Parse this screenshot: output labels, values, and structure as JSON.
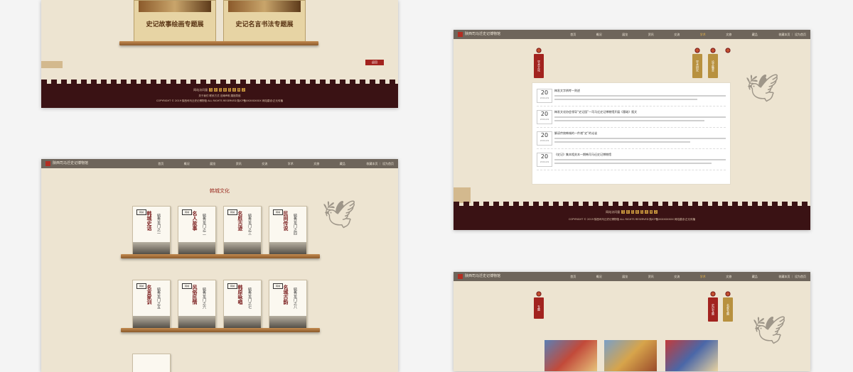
{
  "site_name": "陕西司马迁史记博物馆",
  "nav_items": [
    "首页",
    "概况",
    "展览",
    "资讯",
    "交流",
    "学术",
    "文旅",
    "藏品"
  ],
  "nav_active": "学术",
  "nav_right": "收藏本页 ｜ 设为首页",
  "panel1": {
    "exhibits": [
      "史记故事绘画专题展",
      "史记名言书法专题展"
    ],
    "back_label": "返回",
    "visitor_label": "网站访问量",
    "visitor_digits": [
      "5",
      "0",
      "5",
      "8",
      "5",
      "4",
      "9",
      "2"
    ],
    "footer_links": "关于我们   联系方式   法律声明   展馆导航",
    "copyright": "COPYRIGHT © 2019 陕西司马迁史记博物馆 ALL RIGHTS RESERVED 陕ICP备XXXXXXXXX    网站建设:正元传播"
  },
  "panel2": {
    "section_title": "韩城文化",
    "books": [
      {
        "title": "韩城史话",
        "series": "毓秀龙门之一",
        "seal": "韩城"
      },
      {
        "title": "名人故事",
        "series": "毓秀龙门之二",
        "seal": "韩城"
      },
      {
        "title": "名胜古迹",
        "series": "毓秀龙门之三",
        "seal": "韩城"
      },
      {
        "title": "民间传说",
        "series": "毓秀龙门之四",
        "seal": "韩城"
      },
      {
        "title": "名言家训",
        "series": "毓秀龙门之五",
        "seal": "韩城"
      },
      {
        "title": "风俗民情",
        "series": "毓秀龙门之六",
        "seal": "韩城"
      },
      {
        "title": "韩原咏唱",
        "series": "毓秀龙门之七",
        "seal": "韩城"
      },
      {
        "title": "名城古韵",
        "series": "毓秀龙门之八",
        "seal": "韩城"
      }
    ]
  },
  "panel3": {
    "tags_left": [
      "学术文化"
    ],
    "tags_right": [
      "学术研究",
      "论文集萃"
    ],
    "news": [
      {
        "day": "20",
        "ym": "2019-09",
        "title": "梅发文字辨考一则述"
      },
      {
        "day": "20",
        "ym": "2019-09",
        "title": "梅发文化协会领导“史记园”—司马迁史记博物馆开展《基础》报文"
      },
      {
        "day": "20",
        "ym": "2019-09",
        "title": "解读传统韩城的一件诸“史”的论谈"
      },
      {
        "day": "20",
        "ym": "2019-09",
        "title": "《史记》集本相关本一期韩司马迁史记博物馆"
      }
    ],
    "visitor_label": "网站访问量",
    "visitor_digits": [
      "5",
      "0",
      "5",
      "8",
      "5",
      "4",
      "9",
      "2"
    ],
    "copyright": "COPYRIGHT © 2019 陕西司马迁史记博物馆 ALL RIGHTS RESERVED 陕ICP备XXXXXXXXX    网站建设:正元传播"
  },
  "panel4": {
    "tags_left": [
      "专题"
    ],
    "tags_right": [
      "史记专题",
      "名家专题"
    ]
  }
}
